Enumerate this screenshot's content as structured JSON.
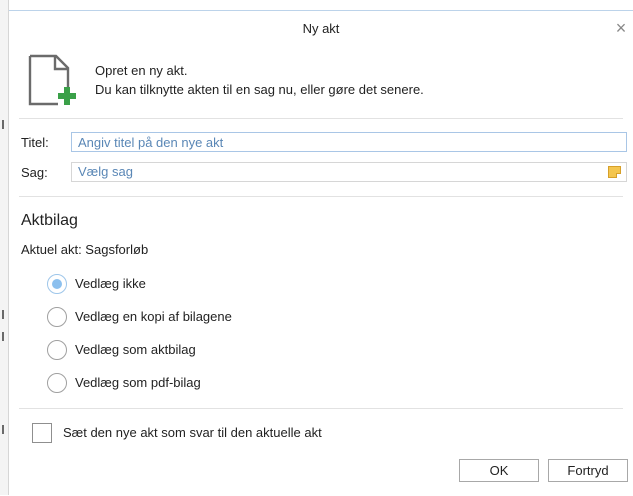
{
  "dialog": {
    "title": "Ny akt",
    "close_glyph": "×",
    "intro": {
      "line1": "Opret en ny akt.",
      "line2": "Du kan tilknytte akten til en sag nu, eller gøre det senere."
    },
    "icon": "new-document-icon"
  },
  "fields": {
    "title_label": "Titel:",
    "title_placeholder": "Angiv titel på den nye akt",
    "case_label": "Sag:",
    "case_placeholder": "Vælg sag",
    "case_picker_icon": "case-picker-icon"
  },
  "attachments": {
    "heading": "Aktbilag",
    "current": "Aktuel akt: Sagsforløb",
    "options": [
      {
        "label": "Vedlæg ikke",
        "checked": true
      },
      {
        "label": "Vedlæg en kopi af bilagene",
        "checked": false
      },
      {
        "label": "Vedlæg som aktbilag",
        "checked": false
      },
      {
        "label": "Vedlæg som pdf-bilag",
        "checked": false
      }
    ]
  },
  "reply_checkbox": {
    "label": "Sæt den nye akt som svar til den aktuelle akt",
    "checked": false
  },
  "buttons": {
    "ok": "OK",
    "cancel": "Fortryd"
  },
  "colors": {
    "accent": "#8cc0ee",
    "input_border": "#a9c6e6",
    "placeholder": "#5a87b6",
    "icon_green": "#3aa048"
  }
}
